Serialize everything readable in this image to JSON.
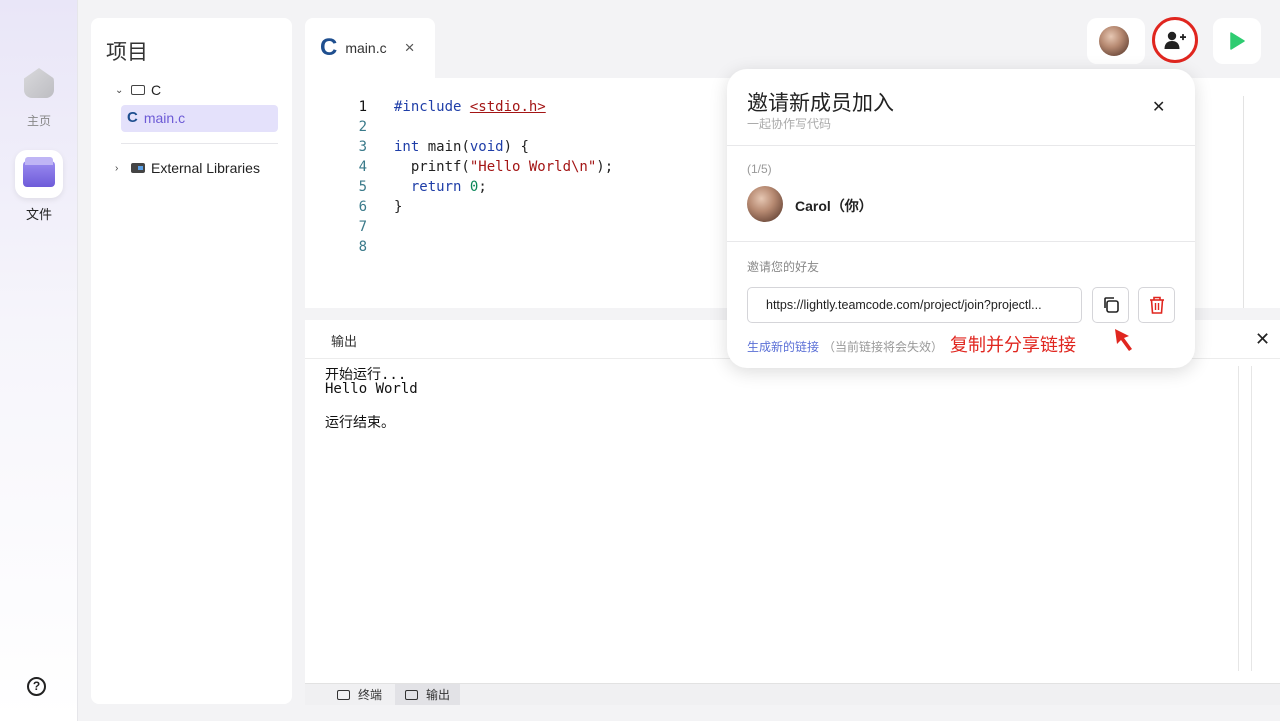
{
  "sidebar": {
    "home_label": "主页",
    "files_label": "文件",
    "help_glyph": "?"
  },
  "project": {
    "title": "项目",
    "tree": {
      "root_label": "C",
      "file_label": "main.c",
      "file_icon_letter": "C",
      "libs_label": "External Libraries"
    }
  },
  "editor": {
    "tab_label": "main.c",
    "tab_icon_letter": "C",
    "tab_close": "×",
    "line_numbers": [
      "1",
      "2",
      "3",
      "4",
      "5",
      "6",
      "7",
      "8"
    ]
  },
  "output": {
    "title": "输出",
    "close": "✕",
    "lines": [
      "开始运行...",
      "Hello World",
      "",
      "运行结束。"
    ]
  },
  "bottom_tabs": {
    "terminal": "终端",
    "output": "输出"
  },
  "invite": {
    "title": "邀请新成员加入",
    "subtitle": "一起协作写代码",
    "close": "✕",
    "member_count": "(1/5)",
    "member_name": "Carol（你）",
    "invite_label": "邀请您的好友",
    "link_value": "https://lightly.teamcode.com/project/join?projectl...",
    "generate_link": "生成新的链接",
    "generate_note": "（当前链接将会失效）",
    "annotation": "复制并分享链接"
  },
  "colors": {
    "accent": "#6d5bd6",
    "highlight_red": "#e0261f",
    "run_green": "#2ecc71",
    "link_blue": "#5a6fd6"
  },
  "icons": {
    "add_user": "add-user-icon",
    "run": "play-icon",
    "copy": "copy-icon",
    "delete": "trash-icon"
  }
}
